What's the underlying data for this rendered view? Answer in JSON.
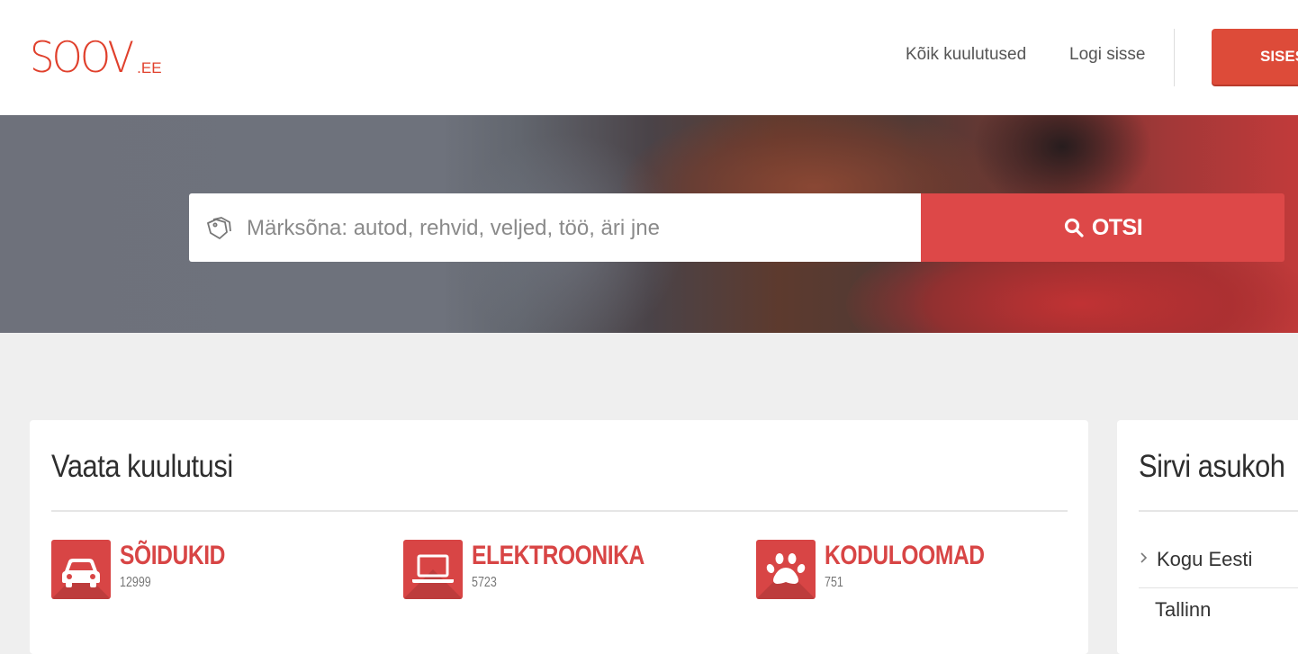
{
  "header": {
    "logo_main": "SOOV",
    "logo_suffix": ".EE",
    "nav": {
      "all_ads": "Kõik kuulutused",
      "login": "Logi sisse",
      "signup": "SISES"
    }
  },
  "search": {
    "placeholder": "Märksõna: autod, rehvid, veljed, töö, äri jne",
    "button_label": "OTSI"
  },
  "main_panel": {
    "title": "Vaata kuulutusi",
    "categories": [
      {
        "name": "SÕIDUKID",
        "count": "12999",
        "icon": "car-icon"
      },
      {
        "name": "ELEKTROONIKA",
        "count": "5723",
        "icon": "laptop-icon"
      },
      {
        "name": "KODULOOMAD",
        "count": "751",
        "icon": "paw-icon"
      }
    ]
  },
  "side_panel": {
    "title": "Sirvi asukoh",
    "items": [
      "Kogu Eesti",
      "Tallinn"
    ]
  },
  "colors": {
    "brand": "#e0402c",
    "accent": "#dd4848",
    "category": "#d84545"
  }
}
